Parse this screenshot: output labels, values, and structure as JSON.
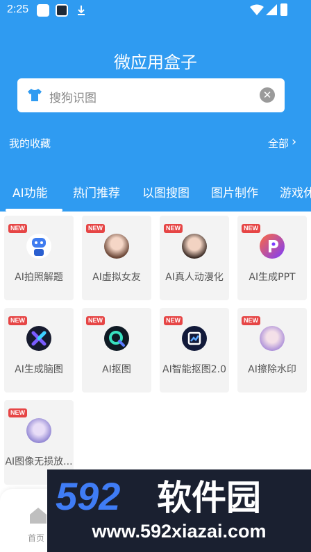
{
  "status_bar": {
    "time": "2:25",
    "app_icons": [
      "browser-app-icon",
      "game-app-icon",
      "download-icon"
    ]
  },
  "header": {
    "title": "微应用盒子"
  },
  "search": {
    "placeholder": "搜狗识图",
    "leading_icon": "shirt-icon",
    "trailing_icon": "clear-icon"
  },
  "favorites": {
    "label": "我的收藏",
    "all_label": "全部"
  },
  "tabs": [
    {
      "label": "AI功能",
      "active": true
    },
    {
      "label": "热门推荐",
      "active": false
    },
    {
      "label": "以图搜图",
      "active": false
    },
    {
      "label": "图片制作",
      "active": false
    },
    {
      "label": "游戏休",
      "active": false
    }
  ],
  "tools": [
    {
      "badge": "NEW",
      "label": "AI拍照解题",
      "icon": "robot-icon"
    },
    {
      "badge": "NEW",
      "label": "AI虚拟女友",
      "icon": "girl-avatar-icon"
    },
    {
      "badge": "NEW",
      "label": "AI真人动漫化",
      "icon": "anime-girl-icon"
    },
    {
      "badge": "NEW",
      "label": "AI生成PPT",
      "icon": "ppt-icon"
    },
    {
      "badge": "NEW",
      "label": "AI生成脑图",
      "icon": "mindmap-icon"
    },
    {
      "badge": "NEW",
      "label": "AI抠图",
      "icon": "cutout-icon"
    },
    {
      "badge": "NEW",
      "label": "AI智能抠图2.0",
      "icon": "smart-cutout-icon"
    },
    {
      "badge": "NEW",
      "label": "AI擦除水印",
      "icon": "erase-watermark-icon"
    },
    {
      "badge": "NEW",
      "label": "AI图像无损放...",
      "icon": "lossless-upscale-icon"
    }
  ],
  "bottom_nav": {
    "home_label": "首页"
  },
  "watermark": {
    "logo": "592软件园",
    "url": "www.592xiazai.com"
  },
  "colors": {
    "primary": "#2f9bf1",
    "badge": "#e64545",
    "card_bg": "#f3f3f3"
  }
}
